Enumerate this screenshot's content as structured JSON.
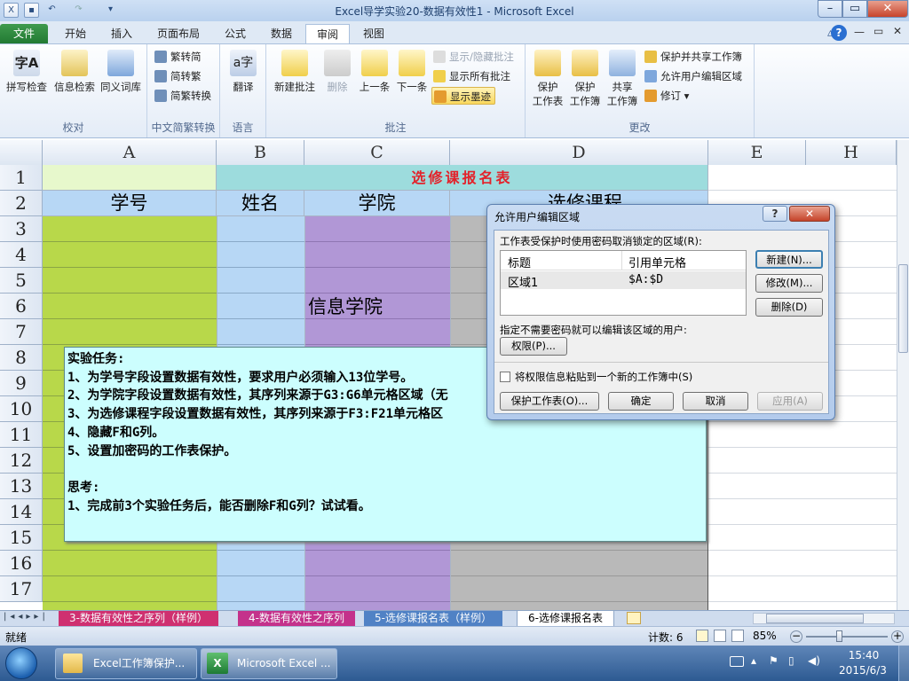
{
  "window": {
    "title": "Excel导学实验20-数据有效性1  -  Microsoft Excel"
  },
  "tabs": [
    "文件",
    "开始",
    "插入",
    "页面布局",
    "公式",
    "数据",
    "审阅",
    "视图"
  ],
  "ribbon": {
    "proofing": {
      "label": "校对",
      "spell": "拼写检查",
      "research": "信息检索",
      "thesaurus": "同义词库"
    },
    "chinese": {
      "label": "中文简繁转换",
      "to_simp": "繁转简",
      "to_trad": "简转繁",
      "convert": "简繁转换"
    },
    "language": {
      "label": "语言",
      "translate": "翻译"
    },
    "comments": {
      "label": "批注",
      "new": "新建批注",
      "delete": "删除",
      "prev": "上一条",
      "next": "下一条",
      "show_hide": "显示/隐藏批注",
      "show_all": "显示所有批注",
      "show_ink": "显示墨迹"
    },
    "changes": {
      "label": "更改",
      "protect_sheet": "保护\n工作表",
      "protect_wb": "保护\n工作簿",
      "share_wb": "共享\n工作簿",
      "protect_share": "保护并共享工作簿",
      "allow_edit": "允许用户编辑区域",
      "track": "修订"
    }
  },
  "columns": [
    "A",
    "B",
    "C",
    "D",
    "E",
    "H"
  ],
  "rows": [
    "1",
    "2",
    "3",
    "4",
    "5",
    "6",
    "7",
    "8",
    "9",
    "10",
    "11",
    "12",
    "13",
    "14",
    "15",
    "16",
    "17"
  ],
  "sheet": {
    "title": "选修课报名表",
    "h_id": "学号",
    "h_name": "姓名",
    "h_college": "学院",
    "h_course": "选修课程",
    "c6": "信息学院"
  },
  "note": {
    "lines": [
      "实验任务:",
      "1、为学号字段设置数据有效性，要求用户必须输入13位学号。",
      "2、为学院字段设置数据有效性，其序列来源于G3:G6单元格区域（无",
      "3、为选修课程字段设置数据有效性，其序列来源于F3:F21单元格区",
      "4、隐藏F和G列。",
      "5、设置加密码的工作表保护。",
      "",
      "思考:",
      "1、完成前3个实验任务后，能否删除F和G列？试试看。"
    ]
  },
  "dialog": {
    "title": "允许用户编辑区域",
    "ranges_label": "工作表受保护时使用密码取消锁定的区域(R):",
    "col_title": "标题",
    "col_ref": "引用单元格",
    "row_title": "区域1",
    "row_ref": "$A:$D",
    "new": "新建(N)...",
    "modify": "修改(M)...",
    "delete": "删除(D)",
    "perm_label": "指定不需要密码就可以编辑该区域的用户:",
    "perm": "权限(P)...",
    "paste_label": "将权限信息粘贴到一个新的工作簿中(S)",
    "protect": "保护工作表(O)...",
    "ok": "确定",
    "cancel": "取消",
    "apply": "应用(A)"
  },
  "sheet_tabs": [
    "3-数据有效性之序列（样例）",
    "4-数据有效性之序列",
    "5-选修课报名表（样例）",
    "6-选修课报名表"
  ],
  "status": {
    "ready": "就绪",
    "count": "计数: 6",
    "zoom": "85%"
  },
  "taskbar": {
    "item1": "Excel工作簿保护...",
    "item2": "Microsoft Excel ...",
    "time": "15:40",
    "date": "2015/6/3"
  },
  "colors": {
    "green": "#b8d84a",
    "blue": "#b7d7f5",
    "purple": "#b197d6",
    "gray": "#b9b9b9",
    "teal": "#9ddcdd",
    "note": "#ccfefe"
  }
}
